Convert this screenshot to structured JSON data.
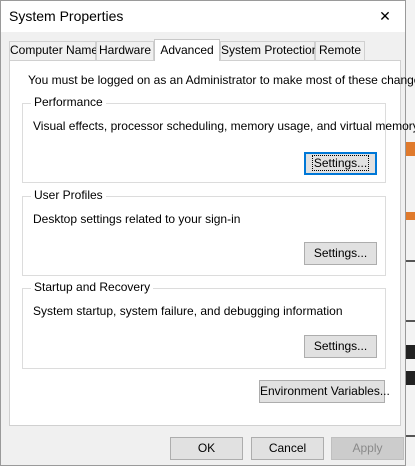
{
  "window": {
    "title": "System Properties",
    "close_symbol": "✕"
  },
  "tabs": [
    {
      "label": "Computer Name"
    },
    {
      "label": "Hardware"
    },
    {
      "label": "Advanced"
    },
    {
      "label": "System Protection"
    },
    {
      "label": "Remote"
    }
  ],
  "panel": {
    "note": "You must be logged on as an Administrator to make most of these changes.",
    "performance": {
      "label": "Performance",
      "description": "Visual effects, processor scheduling, memory usage, and virtual memory",
      "button": "Settings..."
    },
    "user_profiles": {
      "label": "User Profiles",
      "description": "Desktop settings related to your sign-in",
      "button": "Settings..."
    },
    "startup_recovery": {
      "label": "Startup and Recovery",
      "description": "System startup, system failure, and debugging information",
      "button": "Settings..."
    },
    "env_button": "Environment Variables..."
  },
  "footer": {
    "ok": "OK",
    "cancel": "Cancel",
    "apply": "Apply"
  },
  "colors": {
    "accent": "#0078d7",
    "window_bg": "#f0f0f0",
    "panel_bg": "#ffffff",
    "strip_accent": "#e07a2c"
  }
}
